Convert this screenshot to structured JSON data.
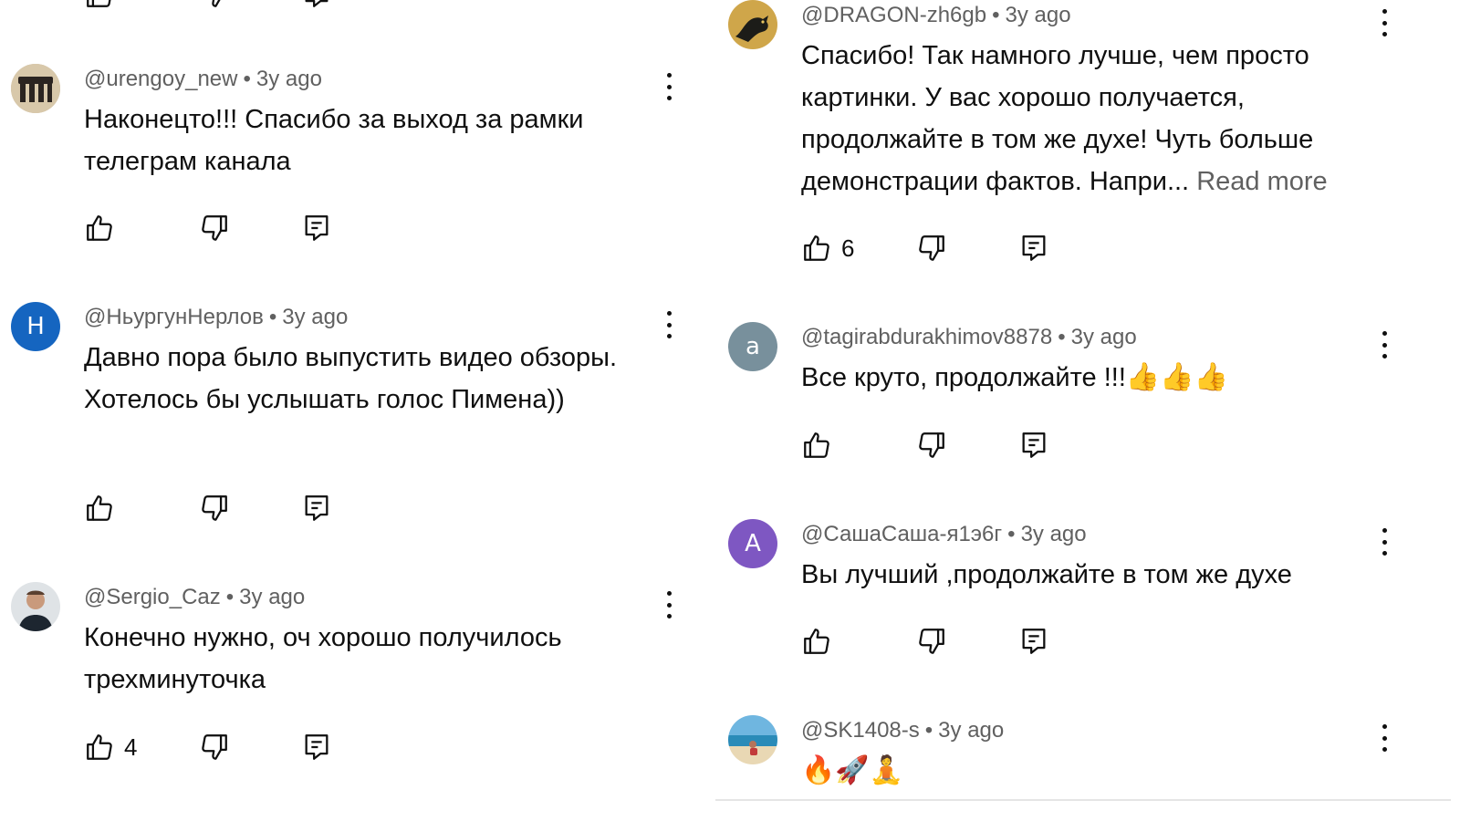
{
  "comments_left": [
    {
      "author": "@urengoy_new",
      "separator": "•",
      "time": "3y ago",
      "text": "Наконецто!!! Спасибо за выход за рамки телеграм канала",
      "likes": "",
      "avatar_icon": "dark-bars-photo-avatar"
    },
    {
      "author": "@НьургунНерлов",
      "separator": "•",
      "time": "3y ago",
      "text": "Давно пора было выпустить видео обзоры. Хотелось бы услышать голос Пимена))",
      "likes": "",
      "avatar_letter": "Н",
      "avatar_color": "#1565c0"
    },
    {
      "author": "@Sergio_Caz",
      "separator": "•",
      "time": "3y ago",
      "text": "Конечно нужно, оч хорошо получилось трехминуточка",
      "likes": "4",
      "avatar_icon": "person-photo-avatar"
    }
  ],
  "comments_right": [
    {
      "author": "@DRAGON-zh6gb",
      "separator": "•",
      "time": "3y ago",
      "text": "Спасибо! Так намного лучше, чем просто картинки. У вас хорошо получается, продолжайте в том же духе! Чуть больше демонстрации фактов. Напри...",
      "read_more": "Read more",
      "likes": "6",
      "avatar_icon": "dragon-photo-avatar"
    },
    {
      "author": "@tagirabdurakhimov8878",
      "separator": "•",
      "time": "3y ago",
      "text": "Все круто, продолжайте !!!",
      "emoji": "👍👍👍",
      "likes": "",
      "avatar_letter": "a",
      "avatar_color": "#78909c"
    },
    {
      "author": "@СашаСаша-я1э6г",
      "separator": "•",
      "time": "3y ago",
      "text": "Вы лучший ,продолжайте в том же духе",
      "likes": "",
      "avatar_letter": "A",
      "avatar_color": "#7e57c2"
    },
    {
      "author": "@SK1408-s",
      "separator": "•",
      "time": "3y ago",
      "text": "",
      "emoji": "🔥🚀🧘",
      "likes": "",
      "avatar_icon": "beach-photo-avatar"
    }
  ],
  "icons": {
    "like": "thumb-up-icon",
    "dislike": "thumb-down-icon",
    "reply": "reply-comment-icon",
    "menu": "more-vertical-icon"
  },
  "colors": {
    "text": "#0f0f0f",
    "meta": "#606060",
    "divider": "#e5e5e5"
  }
}
